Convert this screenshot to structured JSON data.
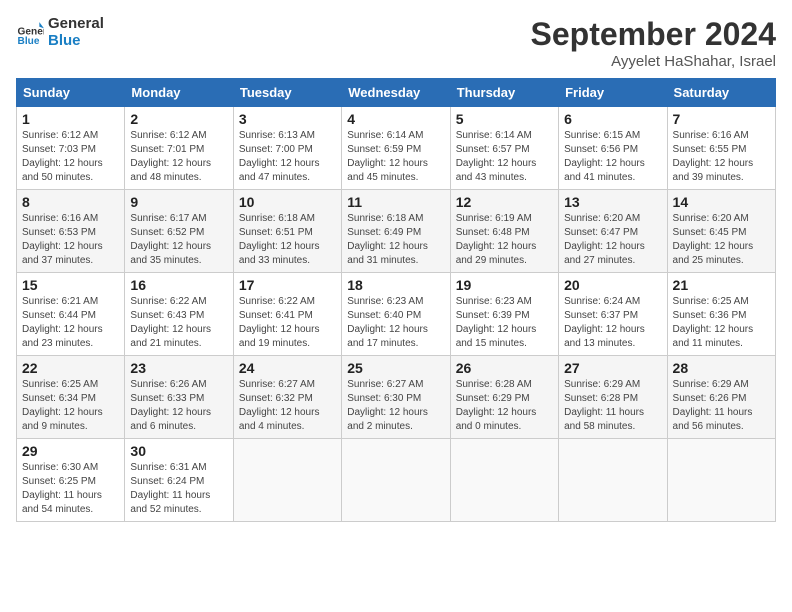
{
  "header": {
    "logo_line1": "General",
    "logo_line2": "Blue",
    "month": "September 2024",
    "location": "Ayyelet HaShahar, Israel"
  },
  "weekdays": [
    "Sunday",
    "Monday",
    "Tuesday",
    "Wednesday",
    "Thursday",
    "Friday",
    "Saturday"
  ],
  "weeks": [
    [
      {
        "day": "1",
        "sunrise": "6:12 AM",
        "sunset": "7:03 PM",
        "daylight": "12 hours and 50 minutes."
      },
      {
        "day": "2",
        "sunrise": "6:12 AM",
        "sunset": "7:01 PM",
        "daylight": "12 hours and 48 minutes."
      },
      {
        "day": "3",
        "sunrise": "6:13 AM",
        "sunset": "7:00 PM",
        "daylight": "12 hours and 47 minutes."
      },
      {
        "day": "4",
        "sunrise": "6:14 AM",
        "sunset": "6:59 PM",
        "daylight": "12 hours and 45 minutes."
      },
      {
        "day": "5",
        "sunrise": "6:14 AM",
        "sunset": "6:57 PM",
        "daylight": "12 hours and 43 minutes."
      },
      {
        "day": "6",
        "sunrise": "6:15 AM",
        "sunset": "6:56 PM",
        "daylight": "12 hours and 41 minutes."
      },
      {
        "day": "7",
        "sunrise": "6:16 AM",
        "sunset": "6:55 PM",
        "daylight": "12 hours and 39 minutes."
      }
    ],
    [
      {
        "day": "8",
        "sunrise": "6:16 AM",
        "sunset": "6:53 PM",
        "daylight": "12 hours and 37 minutes."
      },
      {
        "day": "9",
        "sunrise": "6:17 AM",
        "sunset": "6:52 PM",
        "daylight": "12 hours and 35 minutes."
      },
      {
        "day": "10",
        "sunrise": "6:18 AM",
        "sunset": "6:51 PM",
        "daylight": "12 hours and 33 minutes."
      },
      {
        "day": "11",
        "sunrise": "6:18 AM",
        "sunset": "6:49 PM",
        "daylight": "12 hours and 31 minutes."
      },
      {
        "day": "12",
        "sunrise": "6:19 AM",
        "sunset": "6:48 PM",
        "daylight": "12 hours and 29 minutes."
      },
      {
        "day": "13",
        "sunrise": "6:20 AM",
        "sunset": "6:47 PM",
        "daylight": "12 hours and 27 minutes."
      },
      {
        "day": "14",
        "sunrise": "6:20 AM",
        "sunset": "6:45 PM",
        "daylight": "12 hours and 25 minutes."
      }
    ],
    [
      {
        "day": "15",
        "sunrise": "6:21 AM",
        "sunset": "6:44 PM",
        "daylight": "12 hours and 23 minutes."
      },
      {
        "day": "16",
        "sunrise": "6:22 AM",
        "sunset": "6:43 PM",
        "daylight": "12 hours and 21 minutes."
      },
      {
        "day": "17",
        "sunrise": "6:22 AM",
        "sunset": "6:41 PM",
        "daylight": "12 hours and 19 minutes."
      },
      {
        "day": "18",
        "sunrise": "6:23 AM",
        "sunset": "6:40 PM",
        "daylight": "12 hours and 17 minutes."
      },
      {
        "day": "19",
        "sunrise": "6:23 AM",
        "sunset": "6:39 PM",
        "daylight": "12 hours and 15 minutes."
      },
      {
        "day": "20",
        "sunrise": "6:24 AM",
        "sunset": "6:37 PM",
        "daylight": "12 hours and 13 minutes."
      },
      {
        "day": "21",
        "sunrise": "6:25 AM",
        "sunset": "6:36 PM",
        "daylight": "12 hours and 11 minutes."
      }
    ],
    [
      {
        "day": "22",
        "sunrise": "6:25 AM",
        "sunset": "6:34 PM",
        "daylight": "12 hours and 9 minutes."
      },
      {
        "day": "23",
        "sunrise": "6:26 AM",
        "sunset": "6:33 PM",
        "daylight": "12 hours and 6 minutes."
      },
      {
        "day": "24",
        "sunrise": "6:27 AM",
        "sunset": "6:32 PM",
        "daylight": "12 hours and 4 minutes."
      },
      {
        "day": "25",
        "sunrise": "6:27 AM",
        "sunset": "6:30 PM",
        "daylight": "12 hours and 2 minutes."
      },
      {
        "day": "26",
        "sunrise": "6:28 AM",
        "sunset": "6:29 PM",
        "daylight": "12 hours and 0 minutes."
      },
      {
        "day": "27",
        "sunrise": "6:29 AM",
        "sunset": "6:28 PM",
        "daylight": "11 hours and 58 minutes."
      },
      {
        "day": "28",
        "sunrise": "6:29 AM",
        "sunset": "6:26 PM",
        "daylight": "11 hours and 56 minutes."
      }
    ],
    [
      {
        "day": "29",
        "sunrise": "6:30 AM",
        "sunset": "6:25 PM",
        "daylight": "11 hours and 54 minutes."
      },
      {
        "day": "30",
        "sunrise": "6:31 AM",
        "sunset": "6:24 PM",
        "daylight": "11 hours and 52 minutes."
      },
      null,
      null,
      null,
      null,
      null
    ]
  ]
}
